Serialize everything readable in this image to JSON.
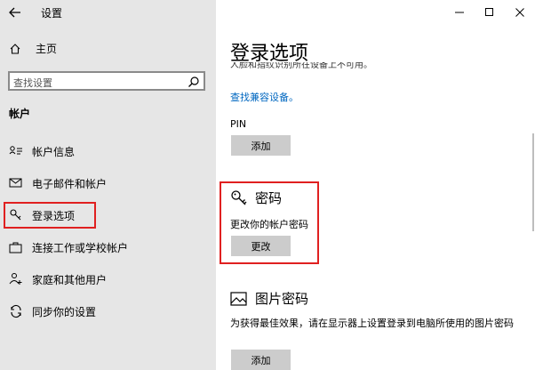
{
  "window": {
    "title": "设置"
  },
  "sidebar": {
    "home_label": "主页",
    "search_placeholder": "查找设置",
    "section_title": "帐户",
    "items": [
      {
        "label": "帐户信息",
        "icon": "account-info-icon"
      },
      {
        "label": "电子邮件和帐户",
        "icon": "mail-icon"
      },
      {
        "label": "登录选项",
        "icon": "key-icon",
        "selected": true
      },
      {
        "label": "连接工作或学校帐户",
        "icon": "briefcase-icon"
      },
      {
        "label": "家庭和其他用户",
        "icon": "family-icon"
      },
      {
        "label": "同步你的设置",
        "icon": "sync-icon"
      }
    ]
  },
  "main": {
    "title": "登录选项",
    "clipped_text": "人脸和指纹识别所在设备上不可用。",
    "compat_link": "查找兼容设备。",
    "pin": {
      "label": "PIN",
      "button": "添加"
    },
    "password": {
      "heading": "密码",
      "description": "更改你的帐户密码",
      "button": "更改"
    },
    "picture_password": {
      "heading": "图片密码",
      "description": "为获得最佳效果，请在显示器上设置登录到电脑所使用的图片密码",
      "button": "添加"
    }
  },
  "colors": {
    "sidebar_bg": "#e6e6e6",
    "highlight_border": "#e02020",
    "link": "#0067c0",
    "button_bg": "#cccccc"
  }
}
